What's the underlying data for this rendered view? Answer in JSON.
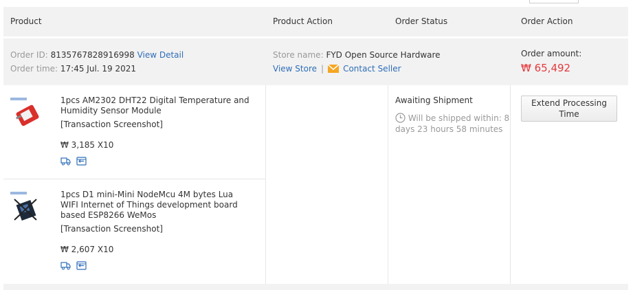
{
  "header": {
    "product": "Product",
    "product_action": "Product Action",
    "order_status": "Order Status",
    "order_action": "Order Action"
  },
  "order": {
    "id_label": "Order ID:",
    "id": "8135767828916998",
    "view_detail": "View Detail",
    "time_label": "Order time:",
    "time": "17:45 Jul. 19 2021",
    "store_label": "Store name:",
    "store_name": "FYD Open Source Hardware",
    "view_store": "View Store",
    "separator": "|",
    "contact_seller": "Contact Seller",
    "amount_label": "Order amount:",
    "amount": "₩ 65,492"
  },
  "items": [
    {
      "name": "1pcs AM2302 DHT22 Digital Temperature and Humidity Sensor Module",
      "snapshot": "[Transaction Screenshot]",
      "price": "₩ 3,185 X10"
    },
    {
      "name": "1pcs D1 mini-Mini NodeMcu 4M bytes Lua WIFI Internet of Things development board based ESP8266 WeMos",
      "snapshot": "[Transaction Screenshot]",
      "price": "₩ 2,607 X10"
    }
  ],
  "status": {
    "text": "Awaiting Shipment",
    "ship_within": "Will be shipped within: 8 days 23 hours 58 minutes"
  },
  "actions": {
    "extend_processing": "Extend Processing Time"
  },
  "icons": {
    "clock": "clock-icon",
    "mail": "mail-icon",
    "shipping": "shipping-icon",
    "return": "return-icon"
  },
  "colors": {
    "link": "#2e6db8",
    "amount": "#e4393c",
    "header_bg": "#f2f2f2"
  }
}
